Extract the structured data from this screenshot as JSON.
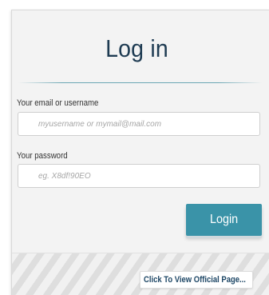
{
  "login_form": {
    "title": "Log in",
    "email_label": "Your email or username",
    "email_placeholder": "myusername or mymail@mail.com",
    "email_value": "",
    "password_label": "Your password",
    "password_placeholder": "eg. X8df!90EO",
    "password_value": "",
    "login_button": "Login"
  },
  "footer": {
    "official_page_link": "Click To View Official Page..."
  },
  "colors": {
    "title": "#1e3b52",
    "accent": "#3a93a8",
    "link": "#1e4766"
  }
}
